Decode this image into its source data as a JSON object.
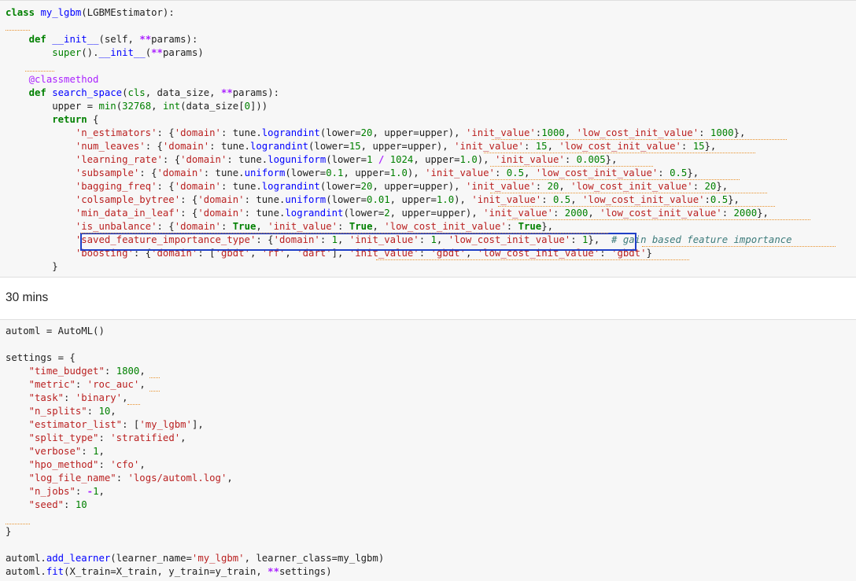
{
  "cell1": {
    "lines": [
      "class my_lgbm(LGBMEstimator):",
      "",
      "    def __init__(self, **params):",
      "        super().__init__(**params)",
      "",
      "    @classmethod",
      "    def search_space(cls, data_size, **params):",
      "        upper = min(32768, int(data_size[0]))",
      "        return {",
      "            'n_estimators': {'domain': tune.lograndint(lower=20, upper=upper), 'init_value':1000, 'low_cost_init_value': 1000},",
      "            'num_leaves': {'domain': tune.lograndint(lower=15, upper=upper), 'init_value': 15, 'low_cost_init_value': 15},",
      "            'learning_rate': {'domain': tune.loguniform(lower=1 / 1024, upper=1.0), 'init_value': 0.005},",
      "            'subsample': {'domain': tune.uniform(lower=0.1, upper=1.0), 'init_value': 0.5, 'low_cost_init_value': 0.5},",
      "            'bagging_freq': {'domain': tune.lograndint(lower=20, upper=upper), 'init_value': 20, 'low_cost_init_value': 20},",
      "            'colsample_bytree': {'domain': tune.uniform(lower=0.01, upper=1.0), 'init_value': 0.5, 'low_cost_init_value':0.5},",
      "            'min_data_in_leaf': {'domain': tune.lograndint(lower=2, upper=upper), 'init_value': 2000, 'low_cost_init_value': 2000},",
      "            'is_unbalance': {'domain': True, 'init_value': True, 'low_cost_init_value': True},",
      "            'saved_feature_importance_type': {'domain': 1, 'init_value': 1, 'low_cost_init_value': 1},  # gain based feature importance",
      "            'boosting': {'domain': ['gbdt', 'rf', 'dart'], 'init_value': 'gbdt', 'low_cost_init_value': 'gbdt'}",
      "        }"
    ]
  },
  "markdown": {
    "text": "30 mins"
  },
  "cell2": {
    "lines": [
      "automl = AutoML()",
      "",
      "settings = {",
      "    \"time_budget\": 1800,",
      "    \"metric\": 'roc_auc',",
      "    \"task\": 'binary',",
      "    \"n_splits\": 10,",
      "    \"estimator_list\": ['my_lgbm'],",
      "    \"split_type\": 'stratified',",
      "    \"verbose\": 1,",
      "    \"hpo_method\": 'cfo',",
      "    \"log_file_name\": 'logs/automl.log',",
      "    \"n_jobs\": -1,",
      "    \"seed\": 10",
      "",
      "}",
      "",
      "automl.add_learner(learner_name='my_lgbm', learner_class=my_lgbm)",
      "automl.fit(X_train=X_train, y_train=y_train, **settings)"
    ]
  },
  "colors": {
    "keyword": "#008000",
    "string": "#ba2121",
    "number": "#008000",
    "operator": "#aa22ff",
    "function": "#0000ff",
    "comment": "#3d7b7b",
    "highlight_box": "#1f3fc7",
    "lint_squiggle": "#e8902a",
    "cell_background": "#f7f7f7"
  }
}
